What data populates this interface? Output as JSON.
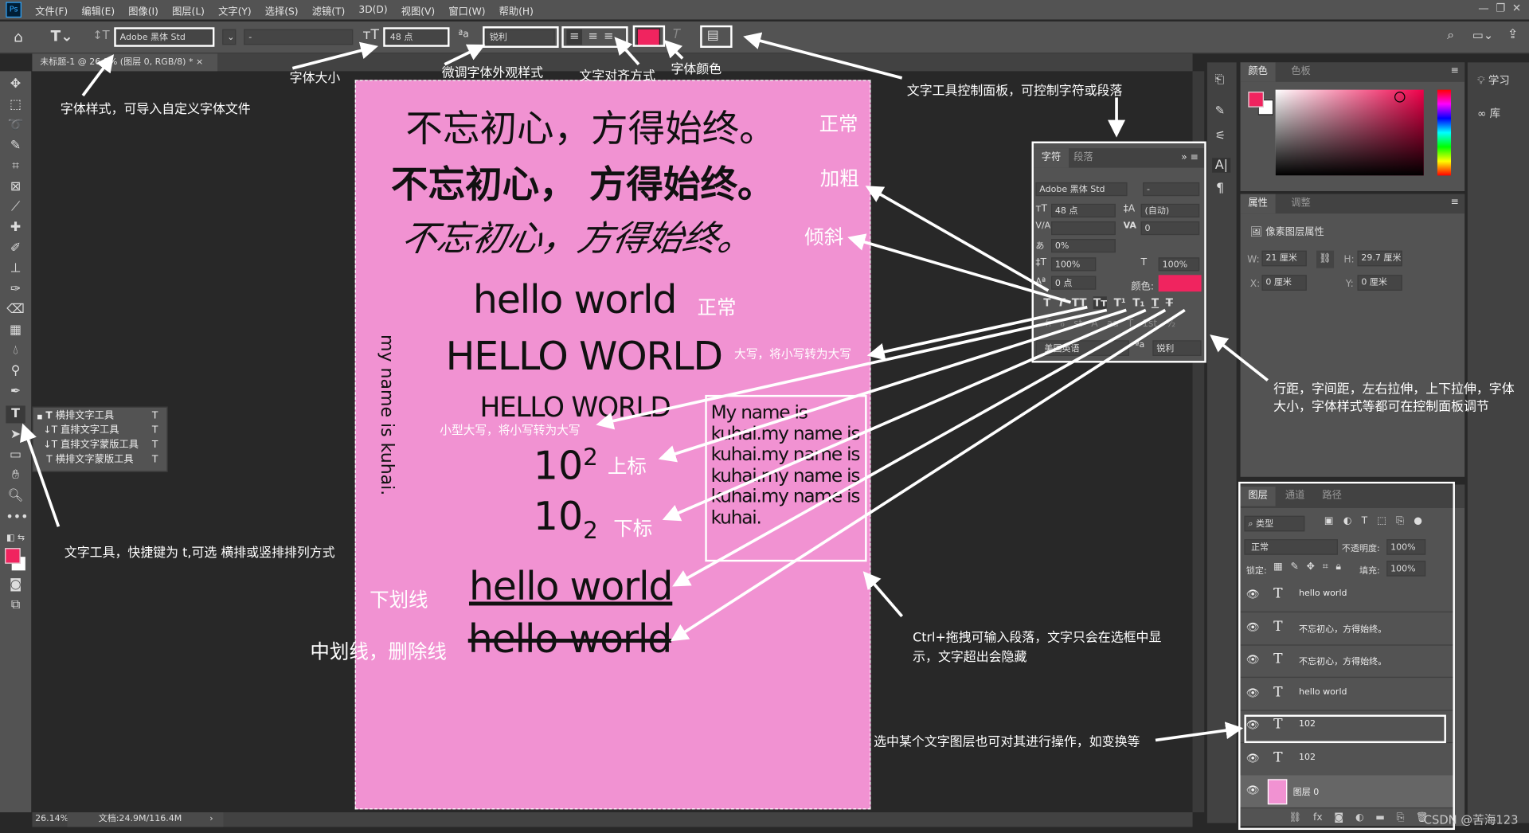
{
  "menubar": {
    "logo": "Ps",
    "items": [
      "文件(F)",
      "编辑(E)",
      "图像(I)",
      "图层(L)",
      "文字(Y)",
      "选择(S)",
      "滤镜(T)",
      "3D(D)",
      "视图(V)",
      "窗口(W)",
      "帮助(H)"
    ]
  },
  "options": {
    "font_family": "Adobe 黑体 Std",
    "font_style": "-",
    "font_size": "48 点",
    "antialias": "锐利",
    "text_color": "#f0245f"
  },
  "document_tab": {
    "title": "未标题-1 @ 26.1% (图层 0, RGB/8) *",
    "close": "×"
  },
  "status": {
    "zoom": "26.14%",
    "doc": "文档:24.9M/116.4M",
    "arrow": "›"
  },
  "tool_flyout": [
    {
      "label": "横排文字工具",
      "shortcut": "T",
      "icon": "horizontal-type-icon"
    },
    {
      "label": "直排文字工具",
      "shortcut": "T",
      "icon": "vertical-type-icon"
    },
    {
      "label": "直排文字蒙版工具",
      "shortcut": "T",
      "icon": "vertical-type-mask-icon"
    },
    {
      "label": "横排文字蒙版工具",
      "shortcut": "T",
      "icon": "horizontal-type-mask-icon"
    }
  ],
  "canvas": {
    "cn_regular": "不忘初心，方得始终。",
    "cn_bold": "不忘初心， 方得始终。",
    "cn_italic": "不忘初心，方得始终。",
    "hello": "hello world",
    "hello_caps": "HELLO WORLD",
    "hello_smallcaps": "HELLO WORLD",
    "sup_base": "10",
    "sup": "2",
    "sub_base": "10",
    "sub": "2",
    "paragraph": "My name is kuhai.my name is kuhai.my name is kuhai.my name is kuhai.my name is kuhai.",
    "vertical": "my name is kuhai.",
    "underline": "hello world",
    "strike": "hello world",
    "labels": {
      "regular": "正常",
      "bold": "加粗",
      "italic": "倾斜",
      "regular2": "正常",
      "allcaps": "大写，将小写转为大写",
      "smallcaps": "小型大写，将小写转为大写",
      "superscript": "上标",
      "subscript": "下标",
      "underline": "下划线",
      "strike": "中划线，删除线"
    }
  },
  "annotations": {
    "font_style": "字体样式，可导入自定义字体文件",
    "font_size": "字体大小",
    "antialias": "微调字体外观样式",
    "align": "文字对齐方式",
    "color": "字体颜色",
    "panel": "文字工具控制面板，可控制字符或段落",
    "panel_detail": [
      "行距，字间距，左右拉伸，上下拉伸，字体",
      "大小，字体样式等都可在控制面板调节"
    ],
    "paragraph": [
      "Ctrl+拖拽可输入段落，文字只会在选框中显",
      "示，文字超出会隐藏"
    ],
    "layer": "选中某个文字图层也可对其进行操作，如变换等",
    "tool": "文字工具，快捷键为 t,可选 横排或竖排排列方式"
  },
  "character_panel": {
    "tabs": [
      "字符",
      "段落"
    ],
    "font": "Adobe 黑体 Std",
    "style": "-",
    "size": "48 点",
    "leading": "(自动)",
    "kerning": "",
    "tracking": "0",
    "tsume": "0%",
    "vscale": "100%",
    "hscale": "100%",
    "baseline": "0 点",
    "color_label": "颜色:",
    "color": "#f0245f",
    "language": "美国英语",
    "antialias": "锐利",
    "styles": [
      "T",
      "T",
      "TT",
      "Tт",
      "T¹",
      "T₁",
      "T",
      "T"
    ],
    "opentype": [
      "fi",
      "ℴ",
      "st",
      "A",
      "aa",
      "T",
      "1st",
      "½"
    ]
  },
  "color_panel": {
    "tabs": [
      "颜色",
      "色板"
    ],
    "foreground": "#f0245f",
    "background": "#ffffff"
  },
  "learn": {
    "learn": "学习",
    "library": "库"
  },
  "properties": {
    "tabs": [
      "属性",
      "调整"
    ],
    "title": "像素图层属性",
    "w_label": "W:",
    "w": "21 厘米",
    "h_label": "H:",
    "h": "29.7 厘米",
    "x_label": "X:",
    "x": "0 厘米",
    "y_label": "Y:",
    "y": "0 厘米"
  },
  "layers": {
    "tabs": [
      "图层",
      "通道",
      "路径"
    ],
    "filter": "类型",
    "blend": "正常",
    "opacity_label": "不透明度:",
    "opacity": "100%",
    "lock_label": "锁定:",
    "fill_label": "填充:",
    "fill": "100%",
    "items": [
      {
        "name": "hello world"
      },
      {
        "name": "不忘初心，方得始终。"
      },
      {
        "name": "不忘初心，方得始终。"
      },
      {
        "name": "hello world"
      },
      {
        "name": "102"
      },
      {
        "name": "102"
      },
      {
        "name": "图层 0"
      }
    ]
  },
  "watermark": "CSDN @苦海123"
}
